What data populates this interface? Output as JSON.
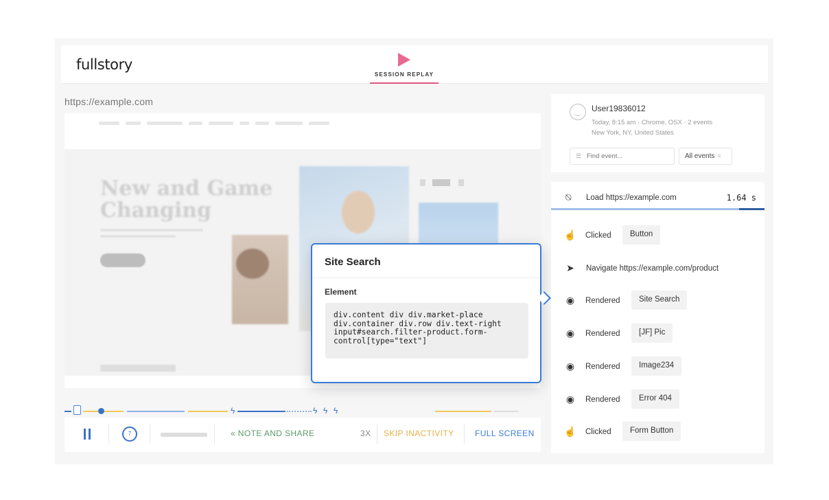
{
  "app": {
    "logo": "fullstory",
    "tab_label": "SESSION REPLAY"
  },
  "page": {
    "url": "https://example.com",
    "hero_heading_line1": "New and Game",
    "hero_heading_line2": "Changing"
  },
  "controls": {
    "rewind_label": "7",
    "note_share": "« NOTE AND SHARE",
    "speed": "3X",
    "skip_inactivity": "SKIP INACTIVITY",
    "full_screen": "FULL SCREEN"
  },
  "popup": {
    "title": "Site Search",
    "element_label": "Element",
    "selector": "div.content div div.market-place\ndiv.container div.row div.text-right\ninput#search.filter-product.form-\ncontrol[type=\"text\"]"
  },
  "user": {
    "name": "User19836012",
    "meta_line1": "Today, 8:15 am · Chrome, OSX · 2 events",
    "meta_line2": "New York, NY, United States",
    "find_placeholder": "Find event...",
    "filter_label": "All events"
  },
  "events": {
    "load": {
      "label": "Load https://example.com",
      "time": "1.64 s",
      "progress": 0.88
    },
    "items": [
      {
        "type": "Clicked",
        "icon": "pointer-hand-icon",
        "chip": "Button"
      },
      {
        "type": "Navigate https://example.com/product",
        "icon": "navigate-arrow-icon",
        "chip": ""
      },
      {
        "type": "Rendered",
        "icon": "eye-icon",
        "chip": "Site Search"
      },
      {
        "type": "Rendered",
        "icon": "eye-icon",
        "chip": "[JF] Pic"
      },
      {
        "type": "Rendered",
        "icon": "eye-icon",
        "chip": "Image234"
      },
      {
        "type": "Rendered",
        "icon": "eye-icon",
        "chip": "Error 404"
      },
      {
        "type": "Clicked",
        "icon": "pointer-hand-icon",
        "chip": "Form Button"
      }
    ]
  },
  "colors": {
    "accent_blue": "#3a7bd5",
    "brand_pink": "#e86a93",
    "note_green": "#5a9a6b",
    "skip_orange": "#e2b34a",
    "timeline_yellow": "#f1c85a"
  }
}
